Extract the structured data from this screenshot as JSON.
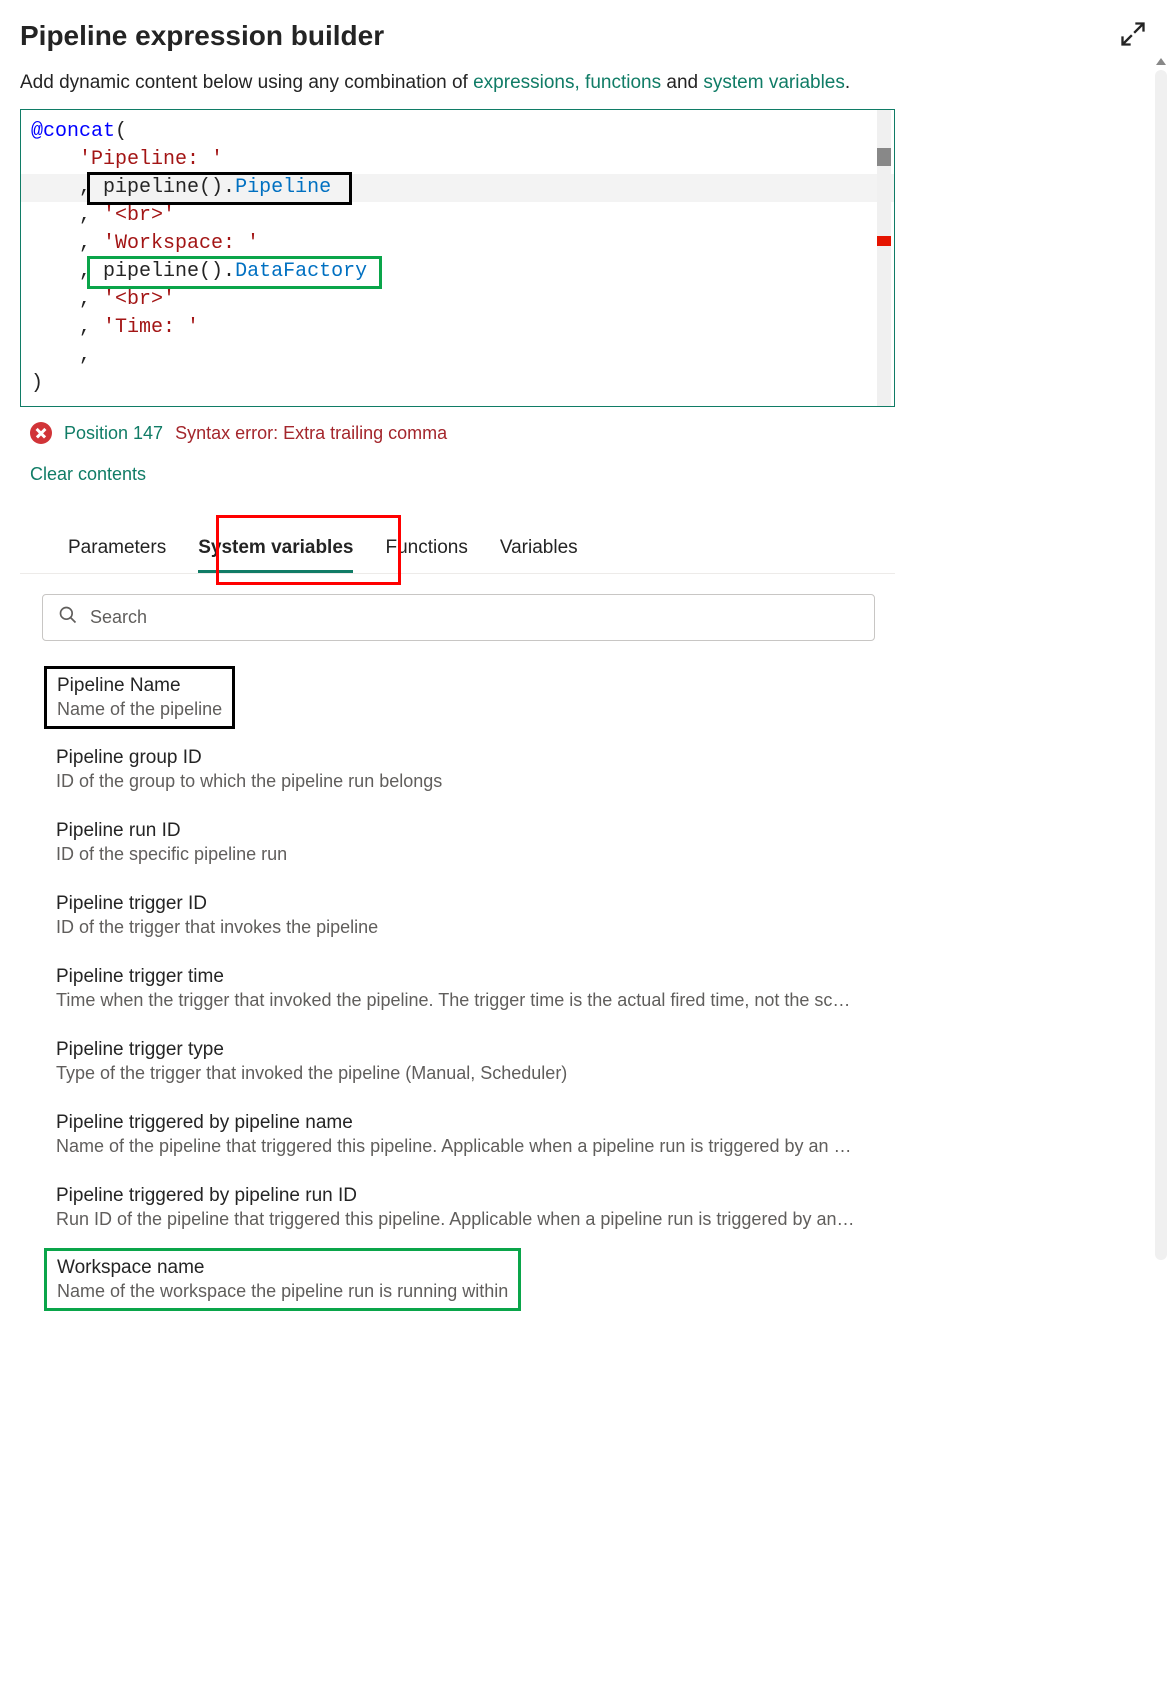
{
  "header": {
    "title": "Pipeline expression builder"
  },
  "description": {
    "prefix": "Add dynamic content below using any combination of ",
    "link_expressions": "expressions,",
    "link_functions": " functions",
    "mid": " and ",
    "link_system_variables": "system variables",
    "suffix": "."
  },
  "editor": {
    "lines": {
      "l1_kw": "@concat",
      "l1_paren": "(",
      "l2_str": "'Pipeline: '",
      "l3_comma": ",",
      "l3_call": " pipeline().",
      "l3_prop": "Pipeline",
      "l4_comma": ",",
      "l4_str": " '<br>'",
      "l5_comma": ",",
      "l5_str": " 'Workspace: '",
      "l6_comma": ",",
      "l6_call": " pipeline().",
      "l6_prop": "DataFactory",
      "l7_comma": ",",
      "l7_str": " '<br>'",
      "l8_comma": ",",
      "l8_str": " 'Time: '",
      "l9_comma": ",",
      "l10_paren": ")"
    }
  },
  "error": {
    "position": "Position 147",
    "message": "Syntax error: Extra trailing comma"
  },
  "clear_label": "Clear contents",
  "tabs": {
    "parameters": "Parameters",
    "system_variables": "System variables",
    "functions": "Functions",
    "variables": "Variables"
  },
  "search": {
    "placeholder": "Search"
  },
  "variables": [
    {
      "name": "Pipeline Name",
      "desc": "Name of the pipeline"
    },
    {
      "name": "Pipeline group ID",
      "desc": "ID of the group to which the pipeline run belongs"
    },
    {
      "name": "Pipeline run ID",
      "desc": "ID of the specific pipeline run"
    },
    {
      "name": "Pipeline trigger ID",
      "desc": "ID of the trigger that invokes the pipeline"
    },
    {
      "name": "Pipeline trigger time",
      "desc": "Time when the trigger that invoked the pipeline. The trigger time is the actual fired time, not the scheduled time."
    },
    {
      "name": "Pipeline trigger type",
      "desc": "Type of the trigger that invoked the pipeline (Manual, Scheduler)"
    },
    {
      "name": "Pipeline triggered by pipeline name",
      "desc": "Name of the pipeline that triggered this pipeline. Applicable when a pipeline run is triggered by an Execute Pipeline activity."
    },
    {
      "name": "Pipeline triggered by pipeline run ID",
      "desc": "Run ID of the pipeline that triggered this pipeline. Applicable when a pipeline run is triggered by an Execute Pipeline activity."
    },
    {
      "name": "Workspace name",
      "desc": "Name of the workspace the pipeline run is running within"
    }
  ]
}
